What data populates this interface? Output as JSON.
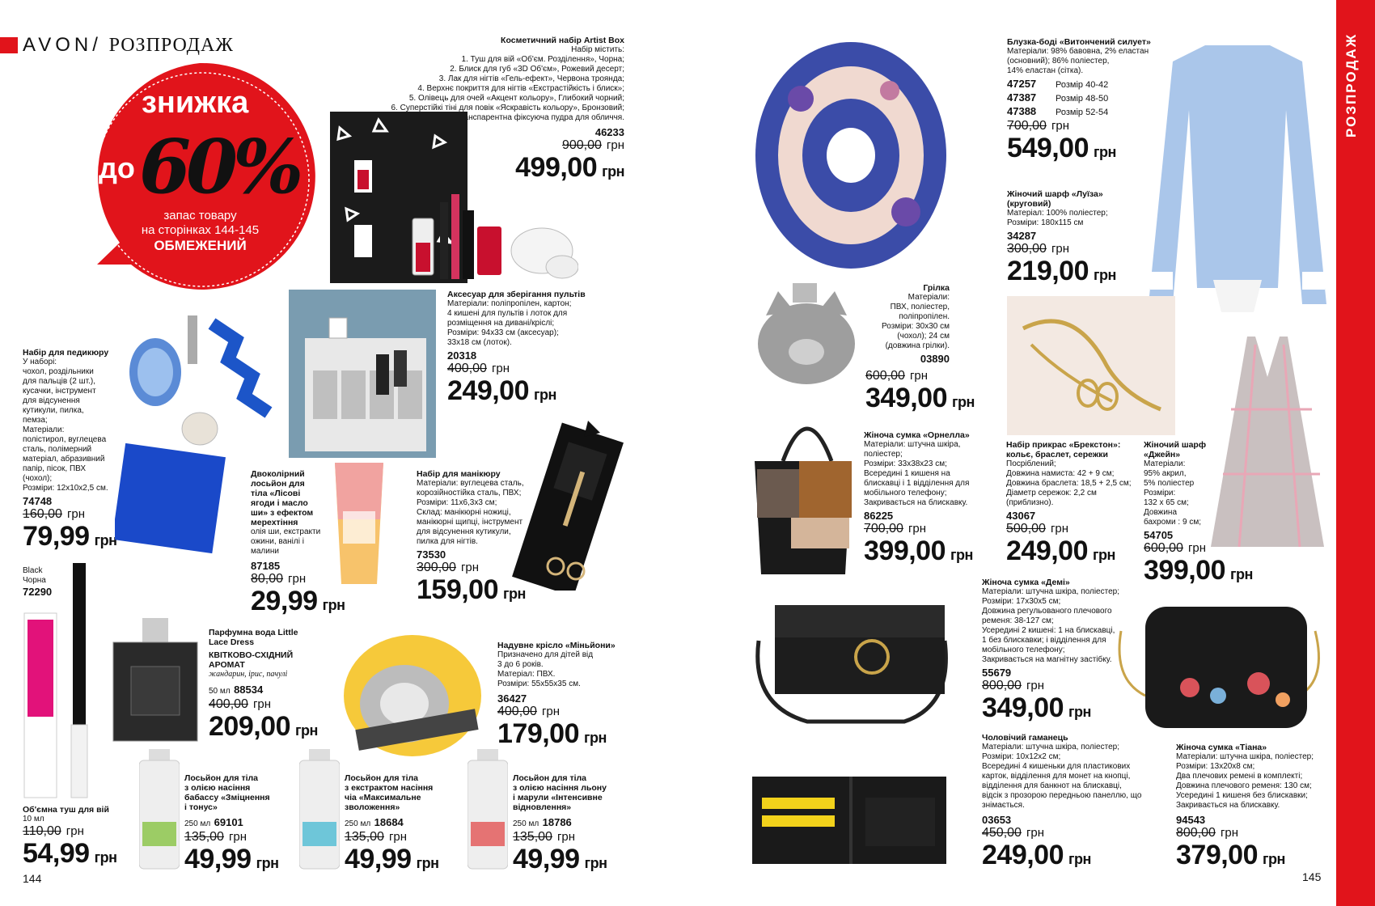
{
  "header": {
    "brand": "AVON",
    "slash": "/",
    "section": "РОЗПРОДАЖ"
  },
  "side_tab": "РОЗПРОДАЖ",
  "promo": {
    "title": "знижка",
    "prefix": "до",
    "value": "60%",
    "note1": "запас товару",
    "note2": "на сторінках 144-145",
    "note3": "ОБМЕЖЕНИЙ"
  },
  "currency": "грн",
  "pages": {
    "left": "144",
    "right": "145"
  },
  "products": {
    "artist_box": {
      "name": "Косметичний набір Artist Box",
      "desc": "Набір містить:\n1. Туш для вій «Об'єм. Розділення», Чорна;\n2. Блиск для губ «3D Об'єм», Рожевий десерт;\n3. Лак для нігтів «Гель-ефект», Червона трояндa;\n4. Верхнє покриття для нігтів «Екстрастійкість і блиск»;\n5. Олівець для очей «Акцент кольору», Глибокий чорний;\n6. Суперстійкі тіні для повік «Яскравість кольору», Бронзовий;\n7. Транспарентна фіксуюча пудра для обличчя.",
      "code": "46233",
      "old": "900,00",
      "price": "499,00"
    },
    "remote": {
      "name": "Аксесуар для зберігання пультів",
      "desc": "Матеріали: поліпропілен, картон;\n4 кишені для пультів і лоток для\nрозміщення на дивані/кріслі;\nРозміри: 94x33 см (аксесуар);\n33x18 см (лоток).",
      "code": "20318",
      "old": "400,00",
      "price": "249,00"
    },
    "pedicure": {
      "name": "Набір для педикюру",
      "desc": "У наборі:\nчохол, роздільники\nдля пальців (2 шт.),\nкусачки, інструмент\nдля відсунення\nкутикули, пилка,\nпемза;\nМатеріали:\nполістирол, вуглецева\nсталь, полімерний\nматеріал, абразивний\nпапір, пісок, ПВХ\n(чохол);\nРозміри: 12x10x2,5 см.",
      "code": "74748",
      "old": "160,00",
      "price": "79,99"
    },
    "lotion_two": {
      "name": "Двоколірний\nлосьйон для\nтіла «Лісові\nягоди і масло\nши» з ефектом\nмерехтіння",
      "desc": "олія ши, екстракти\nожини, ванілі і\nмалини",
      "code": "87185",
      "old": "80,00",
      "price": "29,99"
    },
    "manicure": {
      "name": "Набір для манікюру",
      "desc": "Матеріали: вуглецева сталь,\nкорозійностійка сталь, ПВХ;\nРозміри: 11x6,3x3 см;\nСклад: манікюрні ножиці,\nманікюрні щипці, інструмент\nдля відсунення кутикули,\nпилка для нігтів.",
      "code": "73530",
      "old": "300,00",
      "price": "159,00"
    },
    "mascara": {
      "shade": "Black\nЧорна",
      "code": "72290",
      "name": "Об'ємна туш для вій",
      "size": "10 мл",
      "old": "110,00",
      "price": "54,99"
    },
    "perfume": {
      "name": "Парфумна вода Little\nLace Dress",
      "aroma": "КВІТКОВО-СХІДНИЙ\nАРОМАТ",
      "notes": "жандарин, ірис, пачулі",
      "size": "50 мл",
      "code": "88534",
      "old": "400,00",
      "price": "209,00"
    },
    "minion": {
      "name": "Надувне крісло «Міньйони»",
      "desc": "Призначено для дітей від\n3 до 6 років.\nМатеріал: ПВХ.\nРозміри: 55x55x35 см.",
      "code": "36427",
      "old": "400,00",
      "price": "179,00"
    },
    "lotion_babassu": {
      "name": "Лосьйон для тіла\nз олією насіння\nбабассу «Зміцнення\nі тонус»",
      "size": "250 мл",
      "code": "69101",
      "old": "135,00",
      "price": "49,99"
    },
    "lotion_chia": {
      "name": "Лосьйон для тіла\nз екстрактом насіння\nчіа «Максимальне\nзволоження»",
      "size": "250 мл",
      "code": "18684",
      "old": "135,00",
      "price": "49,99"
    },
    "lotion_flax": {
      "name": "Лосьйон для тіла\nз олією насіння льону\nі марули «Інтенсивне\nвідновлення»",
      "size": "250 мл",
      "code": "18786",
      "old": "135,00",
      "price": "49,99"
    },
    "blouse": {
      "name": "Блузка-боді «Витончений силует»",
      "desc": "Матеріали: 98% бавовна, 2% еластан\n(основний); 86% поліестер,\n14% еластан (сітка).",
      "sizes": [
        {
          "code": "47257",
          "label": "Розмір 40-42"
        },
        {
          "code": "47387",
          "label": "Розмір 48-50"
        },
        {
          "code": "47388",
          "label": "Розмір 52-54"
        }
      ],
      "old": "700,00",
      "price": "549,00"
    },
    "scarf_luiza": {
      "name": "Жіночий шарф «Луїза»\n(круговий)",
      "desc": "Матеріал: 100% поліестер;\nРозміри: 180x115 см",
      "code": "34287",
      "old": "300,00",
      "price": "219,00"
    },
    "heater": {
      "name": "Грілка",
      "desc": "Матеріали:\nПВХ, поліестер,\nполіпропілен.\nРозміри: 30x30 см\n(чохол); 24 см\n(довжина грілки).",
      "code": "03890",
      "old": "600,00",
      "price": "349,00"
    },
    "bag_ornella": {
      "name": "Жіноча сумка «Орнелла»",
      "desc": "Матеріали: штучна шкіра,\nполіестер;\nРозміри: 33x38x23 см;\nВсередині 1 кишеня на\nблискавці і 1 відділення для\nмобільного телефону;\nЗакривається на блискавку.",
      "code": "86225",
      "old": "700,00",
      "price": "399,00"
    },
    "jewelry": {
      "name": "Набір прикрас «Брекстон»:\nкольє, браслет, сережки",
      "desc": "Посріблений;\nДовжина намиста: 42 + 9 см;\nДовжина браслета: 18,5 + 2,5 см;\nДіаметр сережок: 2,2 см\n(приблизно).",
      "code": "43067",
      "old": "500,00",
      "price": "249,00"
    },
    "scarf_jane": {
      "name": "Жіночий шарф\n«Джейн»",
      "desc": "Матеріали:\n95% акрил,\n5% поліестер\nРозміри:\n132 x 65 см;\nДовжина\nбахроми : 9 см;",
      "code": "54705",
      "old": "600,00",
      "price": "399,00"
    },
    "bag_demi": {
      "name": "Жіноча сумка «Демі»",
      "desc": "Матеріали: штучна шкіра, поліестер;\nРозміри: 17x30x5 см;\nДовжина регульованого плечового\nременя: 38-127 см;\nУсередині 2 кишені: 1 на блискавці,\n1 без блискавки; і відділення для\nмобільного телефону;\nЗакривається на магнітну застібку.",
      "code": "55679",
      "old": "800,00",
      "price": "349,00"
    },
    "wallet": {
      "name": "Чоловічий гаманець",
      "desc": "Матеріали: штучна шкіра, поліестер;\nРозміри: 10x12x2 см;\nВсередині 4 кишеньки для пластикових\nкарток, відділення для монет на кнопці,\nвідділення для банкнот на блискавці,\nвідсік з прозорою передньою панеллю, що\nзнімається.",
      "code": "03653",
      "old": "450,00",
      "price": "249,00"
    },
    "bag_tiana": {
      "name": "Жіноча сумка «Тіана»",
      "desc": "Матеріали: штучна шкіра, поліестер;\nРозміри: 13x20x8 см;\nДва плечових ремені в комплекті;\nДовжина плечового ременя: 130 см;\nУсередині 1 кишеня без блискавки;\nЗакривається на блискавку.",
      "code": "94543",
      "old": "800,00",
      "price": "379,00"
    }
  }
}
